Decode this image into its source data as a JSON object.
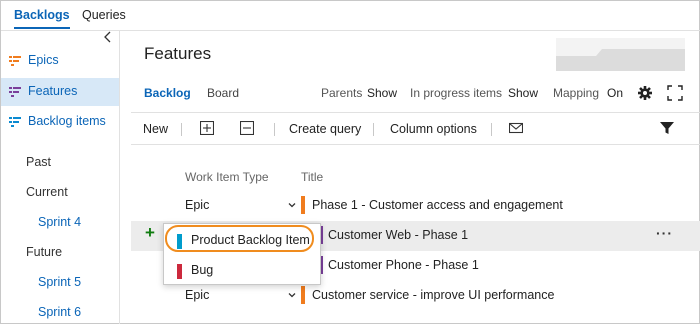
{
  "top_tabs": [
    {
      "label": "Backlogs",
      "active": true
    },
    {
      "label": "Queries",
      "active": false
    }
  ],
  "sidebar": {
    "collapse_icon": "chevron-left-icon",
    "items": [
      {
        "label": "Epics",
        "icon": "backlog-epics-icon",
        "color": "#f07c1e",
        "selected": false
      },
      {
        "label": "Features",
        "icon": "backlog-features-icon",
        "color": "#7a3f9a",
        "selected": true
      },
      {
        "label": "Backlog items",
        "icon": "backlog-items-icon",
        "color": "#0b8ad1",
        "selected": false
      }
    ],
    "iterations": {
      "past_label": "Past",
      "current_label": "Current",
      "current_sprints": [
        "Sprint 4"
      ],
      "future_label": "Future",
      "future_sprints": [
        "Sprint 5",
        "Sprint 6"
      ]
    }
  },
  "main": {
    "title": "Features",
    "view_tabs": [
      {
        "label": "Backlog",
        "active": true
      },
      {
        "label": "Board",
        "active": false
      }
    ],
    "options": {
      "parents_label": "Parents",
      "parents_value": "Show",
      "in_progress_label": "In progress items",
      "in_progress_value": "Show",
      "mapping_label": "Mapping",
      "mapping_value": "On"
    },
    "header_icons": [
      "gear-icon",
      "fullscreen-icon"
    ],
    "toolbar": {
      "new_label": "New",
      "expand_icon": "expand-all-icon",
      "collapse_icon": "collapse-all-icon",
      "create_query_label": "Create query",
      "column_options_label": "Column options",
      "email_icon": "email-icon",
      "filter_icon": "filter-icon"
    },
    "columns": [
      "Work Item Type",
      "Title"
    ],
    "rows": [
      {
        "type": "Epic",
        "title": "Phase 1 - Customer access and engagement",
        "color": "#f07c1e"
      },
      {
        "type": "",
        "title": "Customer Web - Phase 1",
        "color": "#7a3f9a"
      },
      {
        "type": "",
        "title": "Customer Phone - Phase 1",
        "color": "#7a3f9a"
      },
      {
        "type": "Epic",
        "title": "Customer service - improve UI performance",
        "color": "#f07c1e"
      }
    ],
    "row_actions": {
      "add_icon": "plus-icon",
      "more_icon": "more-actions-icon"
    }
  },
  "add_menu": {
    "items": [
      {
        "label": "Product Backlog Item",
        "color": "#009ccc"
      },
      {
        "label": "Bug",
        "color": "#cc293d"
      }
    ],
    "highlight_color": "#f08c1e"
  }
}
